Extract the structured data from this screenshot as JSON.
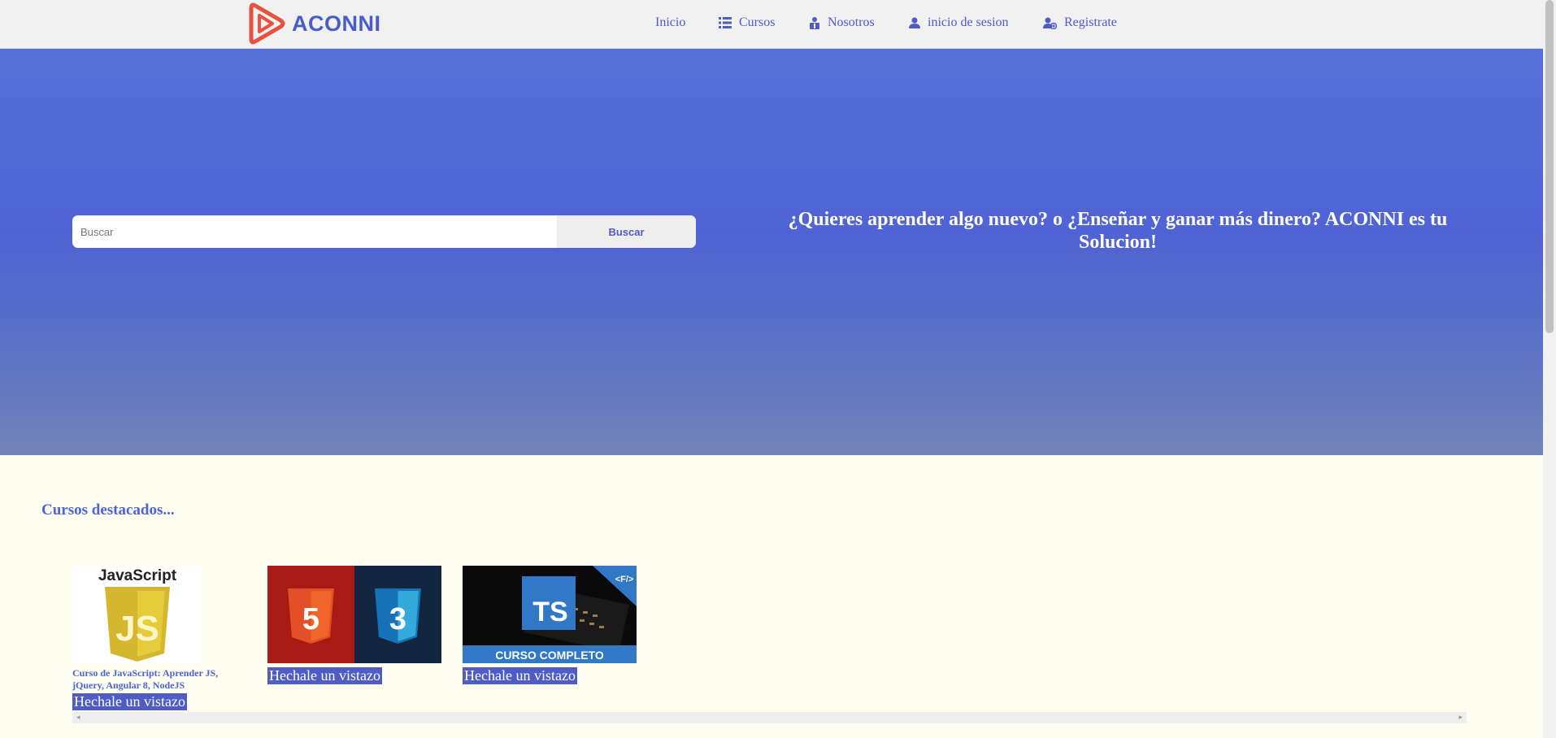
{
  "brand": {
    "name": "ACONNI",
    "accent": "#4a5cc9",
    "logo_color": "#e8503f"
  },
  "nav": {
    "items": [
      {
        "label": "Inicio",
        "icon": ""
      },
      {
        "label": "Cursos",
        "icon": "list-icon"
      },
      {
        "label": "Nosotros",
        "icon": "users-icon"
      },
      {
        "label": "inicio de sesion",
        "icon": "user-icon"
      },
      {
        "label": "Registrate",
        "icon": "user-plus-icon"
      }
    ]
  },
  "hero": {
    "search_placeholder": "Buscar",
    "search_button": "Buscar",
    "tagline": "¿Quieres aprender algo nuevo? o ¿Enseñar y ganar más dinero? ACONNI es tu Solucion!"
  },
  "featured": {
    "title": "Cursos destacados...",
    "courses": [
      {
        "thumb_label": "JavaScript",
        "thumb_badge": "JS",
        "title": "Curso de JavaScript: Aprender JS, jQuery, Angular 8, NodeJS",
        "cta": "Hechale un vistazo"
      },
      {
        "thumb_badge_left": "5",
        "thumb_badge_right": "3",
        "cta": "Hechale un vistazo"
      },
      {
        "thumb_badge": "TS",
        "thumb_corner": "<F/>",
        "thumb_banner": "CURSO COMPLETO",
        "cta": "Hechale un vistazo"
      }
    ]
  }
}
